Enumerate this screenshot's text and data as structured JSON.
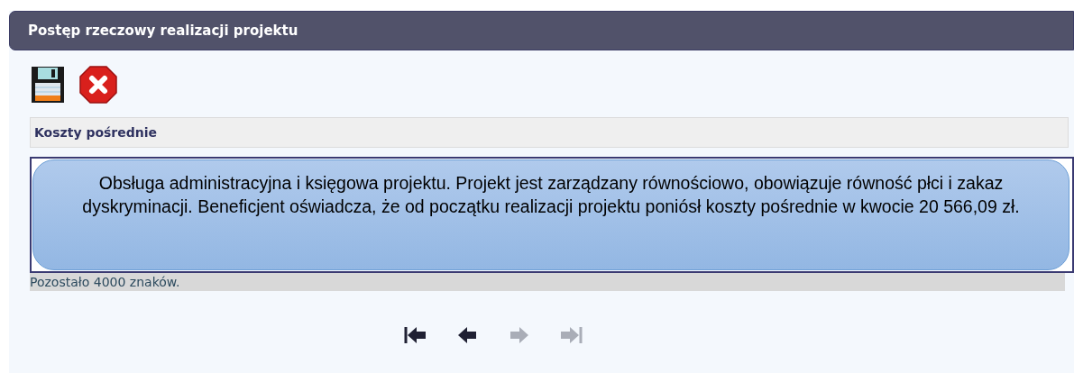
{
  "panel": {
    "title": "Postęp rzeczowy realizacji projektu"
  },
  "toolbar": [
    {
      "kind": "save"
    },
    {
      "kind": "cancel"
    }
  ],
  "section": {
    "label": "Koszty pośrednie"
  },
  "description": {
    "value": "Obsługa administracyjna i księgowa projektu. Projekt jest zarządzany równościowo, obowiązuje równość płci i zakaz dyskryminacji. Beneficjent oświadcza, że od początku realizacji projektu poniósł koszty pośrednie w kwocie 20 566,09 zł.",
    "counter": "Pozostało 4000 znaków."
  },
  "pager": [
    {
      "kind": "first",
      "disabled": false
    },
    {
      "kind": "previous",
      "disabled": false
    },
    {
      "kind": "next",
      "disabled": true
    },
    {
      "kind": "last",
      "disabled": true
    }
  ]
}
